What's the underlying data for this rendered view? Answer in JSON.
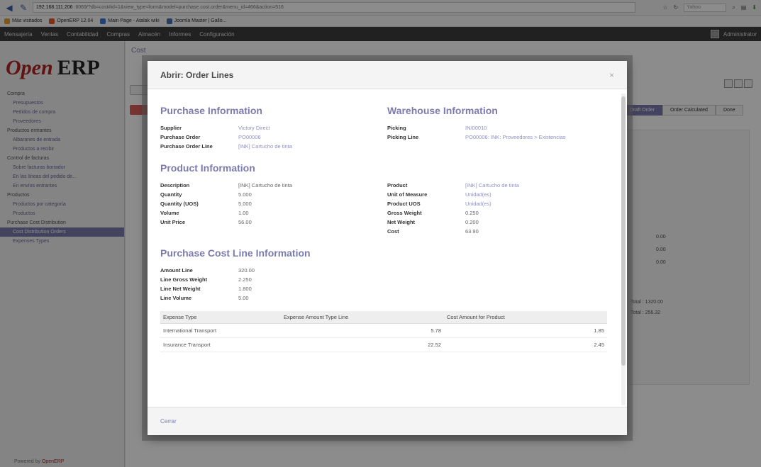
{
  "browser": {
    "url_host": "192.168.111.206",
    "url_rest": ":8069/?db=cost#id=1&view_type=form&model=purchase.cost.order&menu_id=466&action=516",
    "search_placeholder": "Yahoo"
  },
  "bookmarks": [
    {
      "label": "Más visitados",
      "color": "#e0a030"
    },
    {
      "label": "OpenERP 12.04",
      "color": "#e35b2b"
    },
    {
      "label": "Main Page - Atalak wiki",
      "color": "#3a7bd5"
    },
    {
      "label": "Joomla Master | Gallo...",
      "color": "#4a6fb0"
    }
  ],
  "app_menu": {
    "items": [
      "Mensajería",
      "Ventas",
      "Contabilidad",
      "Compras",
      "Almacén",
      "Informes",
      "Configuración"
    ],
    "user": "Administrator"
  },
  "sidebar": {
    "logo_open": "Open",
    "logo_erp": "ERP",
    "sections": [
      {
        "title": "Compra",
        "items": [
          "Presupuestos",
          "Pedidos de compra",
          "Proveedores"
        ]
      },
      {
        "title": "Productos entrantes",
        "items": [
          "Albaranes de entrada",
          "Productos a recibir"
        ]
      },
      {
        "title": "Control de facturas",
        "items": [
          "Sobre facturas borrador",
          "En las líneas del pedido de...",
          "En envíos entrantes"
        ]
      },
      {
        "title": "Productos",
        "items": [
          "Productos por categoría",
          "Productos"
        ]
      },
      {
        "title": "Purchase Cost Distribution",
        "items": [
          "Cost Distribution Orders",
          "Expenses Types"
        ]
      }
    ],
    "active_item": "Cost Distribution Orders",
    "powered_prefix": "Powered by",
    "powered_brand": "OpenERP"
  },
  "background": {
    "crumb": "Cost",
    "status_steps": [
      "Draft Order",
      "Order Calculated",
      "Done"
    ],
    "numbers": [
      "0.00",
      "0.00",
      "0.00",
      "Total : 1320.00",
      "Total : 256.32"
    ]
  },
  "dialog": {
    "title": "Abrir: Order Lines",
    "close_glyph": "×",
    "cancel_label": "Cerrar",
    "purchase_info": {
      "title": "Purchase Information",
      "fields": [
        {
          "label": "Supplier",
          "value": "Victory Direct"
        },
        {
          "label": "Purchase Order",
          "value": "PO00006"
        },
        {
          "label": "Purchase Order Line",
          "value": "[INK] Cartucho de tinta"
        }
      ]
    },
    "warehouse_info": {
      "title": "Warehouse Information",
      "fields": [
        {
          "label": "Picking",
          "value": "IN/00010"
        },
        {
          "label": "Picking Line",
          "value": "PO00006: INK: Proveedores > Existencias"
        }
      ]
    },
    "product_info": {
      "title": "Product Information",
      "left": [
        {
          "label": "Description",
          "value": "[INK] Cartucho de tinta"
        },
        {
          "label": "Quantity",
          "value": "5.000"
        },
        {
          "label": "Quantity (UOS)",
          "value": "5.000"
        },
        {
          "label": "Volume",
          "value": "1.00"
        },
        {
          "label": "Unit Price",
          "value": "56.00"
        }
      ],
      "right": [
        {
          "label": "Product",
          "value": "[INK] Cartucho de tinta"
        },
        {
          "label": "Unit of Measure",
          "value": "Unidad(es)"
        },
        {
          "label": "Product UOS",
          "value": "Unidad(es)"
        },
        {
          "label": "Gross Weight",
          "value": "0.250"
        },
        {
          "label": "Net Weight",
          "value": "0.200"
        },
        {
          "label": "Cost",
          "value": "63.90"
        }
      ]
    },
    "cost_line_info": {
      "title": "Purchase Cost Line Information",
      "fields": [
        {
          "label": "Amount Line",
          "value": "320.00"
        },
        {
          "label": "Line Gross Weight",
          "value": "2.250"
        },
        {
          "label": "Line Net Weight",
          "value": "1.800"
        },
        {
          "label": "Line Volume",
          "value": "5.00"
        }
      ]
    },
    "expenses_table": {
      "headers": [
        "Expense Type",
        "Expense Amount Type Line",
        "Cost Amount for Product"
      ],
      "rows": [
        [
          "International Transport",
          "5.78",
          "1.85"
        ],
        [
          "Insurance Transport",
          "22.52",
          "2.45"
        ]
      ]
    }
  }
}
